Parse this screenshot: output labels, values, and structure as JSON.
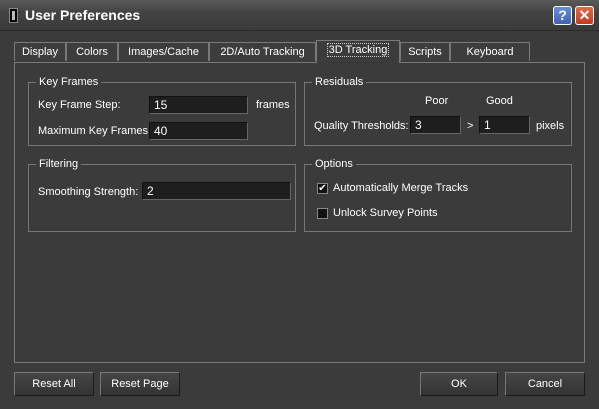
{
  "window": {
    "title": "User Preferences",
    "help_glyph": "?",
    "close_glyph": "✕"
  },
  "tabs": [
    {
      "label": "Display"
    },
    {
      "label": "Colors"
    },
    {
      "label": "Images/Cache"
    },
    {
      "label": "2D/Auto Tracking"
    },
    {
      "label": "3D Tracking",
      "active": true
    },
    {
      "label": "Scripts"
    },
    {
      "label": "Keyboard"
    }
  ],
  "key_frames": {
    "title": "Key Frames",
    "step_label": "Key Frame Step:",
    "step_value": "15",
    "step_unit": "frames",
    "max_label": "Maximum Key Frames:",
    "max_value": "40"
  },
  "residuals": {
    "title": "Residuals",
    "poor_label": "Poor",
    "good_label": "Good",
    "threshold_label": "Quality Thresholds:",
    "poor_value": "3",
    "separator": ">",
    "good_value": "1",
    "unit": "pixels"
  },
  "filtering": {
    "title": "Filtering",
    "smoothing_label": "Smoothing Strength:",
    "smoothing_value": "2"
  },
  "options": {
    "title": "Options",
    "merge_label": "Automatically Merge Tracks",
    "merge_checked": true,
    "unlock_label": "Unlock Survey Points",
    "unlock_checked": false
  },
  "buttons": {
    "reset_all": "Reset All",
    "reset_page": "Reset Page",
    "ok": "OK",
    "cancel": "Cancel"
  }
}
